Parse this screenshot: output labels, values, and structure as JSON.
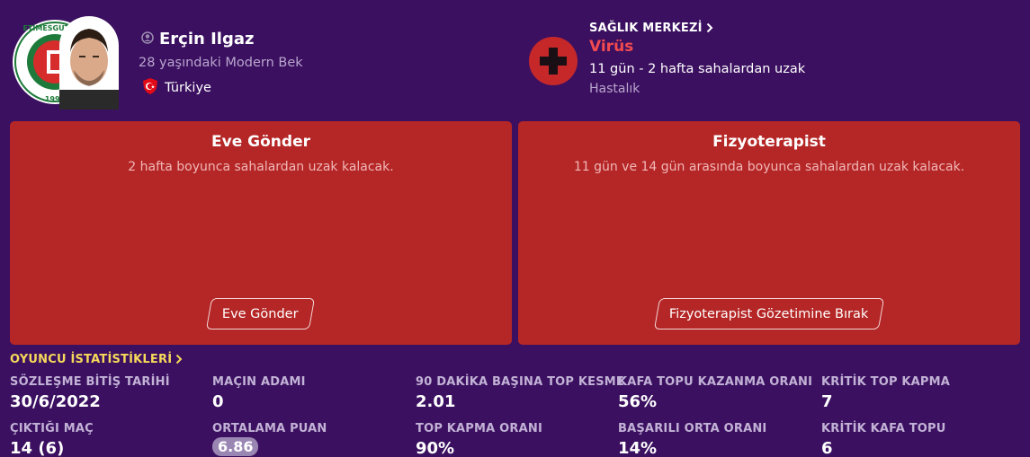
{
  "player": {
    "name": "Erçin Ilgaz",
    "description": "28 yaşındaki Modern Bek",
    "nationality": "Türkiye",
    "club_logo_text": "ETİMESGUT BEL",
    "club_logo_year": "1990"
  },
  "medical": {
    "section_title": "SAĞLIK MERKEZİ",
    "injury_name": "Virüs",
    "duration": "11 gün - 2 hafta sahalardan uzak",
    "type": "Hastalık"
  },
  "options": [
    {
      "title": "Eve Gönder",
      "description": "2 hafta boyunca sahalardan uzak kalacak.",
      "button": "Eve Gönder"
    },
    {
      "title": "Fizyoterapist",
      "description": "11 gün ve 14 gün arasında boyunca sahalardan uzak kalacak.",
      "button": "Fizyoterapist Gözetimine Bırak"
    }
  ],
  "stats": {
    "section_title": "OYUNCU İSTATİSTİKLERİ",
    "items": [
      {
        "label": "SÖZLEŞME BİTİŞ TARİHİ",
        "value": "30/6/2022"
      },
      {
        "label": "MAÇIN ADAMI",
        "value": "0"
      },
      {
        "label": "90 DAKİKA BAŞINA TOP KESME",
        "value": "2.01"
      },
      {
        "label": "KAFA TOPU KAZANMA ORANI",
        "value": "56%"
      },
      {
        "label": "KRİTİK TOP KAPMA",
        "value": "7"
      },
      {
        "label": "ÇIKTIĞI MAÇ",
        "value": "14 (6)"
      },
      {
        "label": "ORTALAMA PUAN",
        "value": "6.86"
      },
      {
        "label": "TOP KAPMA ORANI",
        "value": "90%"
      },
      {
        "label": "BAŞARILI ORTA ORANI",
        "value": "14%"
      },
      {
        "label": "KRİTİK KAFA TOPU",
        "value": "6"
      }
    ]
  },
  "colors": {
    "background": "#3b1060",
    "card": "#b52626",
    "injury": "#f24a4f",
    "stats_title": "#f6d95a"
  }
}
